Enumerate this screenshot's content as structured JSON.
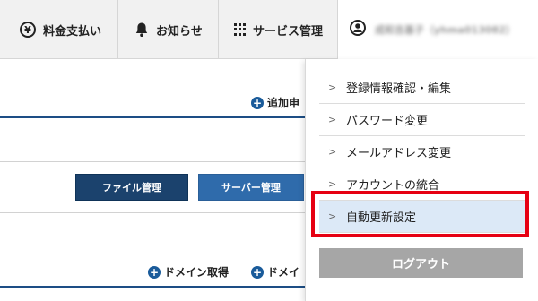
{
  "topnav": {
    "payment": {
      "label": "料金支払い",
      "icon": "yen-icon"
    },
    "notice": {
      "label": "お知らせ",
      "icon": "bell-icon"
    },
    "services": {
      "label": "サービス管理",
      "icon": "grid-icon"
    },
    "user": {
      "name": "成和吉基子（yhma013082）",
      "icon": "user-icon"
    }
  },
  "main": {
    "add_link_label": "追加申",
    "buttons": {
      "file_manage": "ファイル管理",
      "server_manage": "サーバー管理"
    },
    "domain_links": {
      "acquire": "ドメイン取得",
      "second": "ドメイ"
    }
  },
  "dropdown": {
    "items": [
      {
        "label": "登録情報確認・編集"
      },
      {
        "label": "パスワード変更"
      },
      {
        "label": "メールアドレス変更"
      },
      {
        "label": "アカウントの統合"
      },
      {
        "label": "自動更新設定"
      }
    ],
    "logout_label": "ログアウト"
  },
  "colors": {
    "primary_dark": "#1b426d",
    "primary": "#2f6bab",
    "highlight_row": "#dce9f7",
    "highlight_frame": "#e60012",
    "logout_bg": "#a6a6a6"
  }
}
